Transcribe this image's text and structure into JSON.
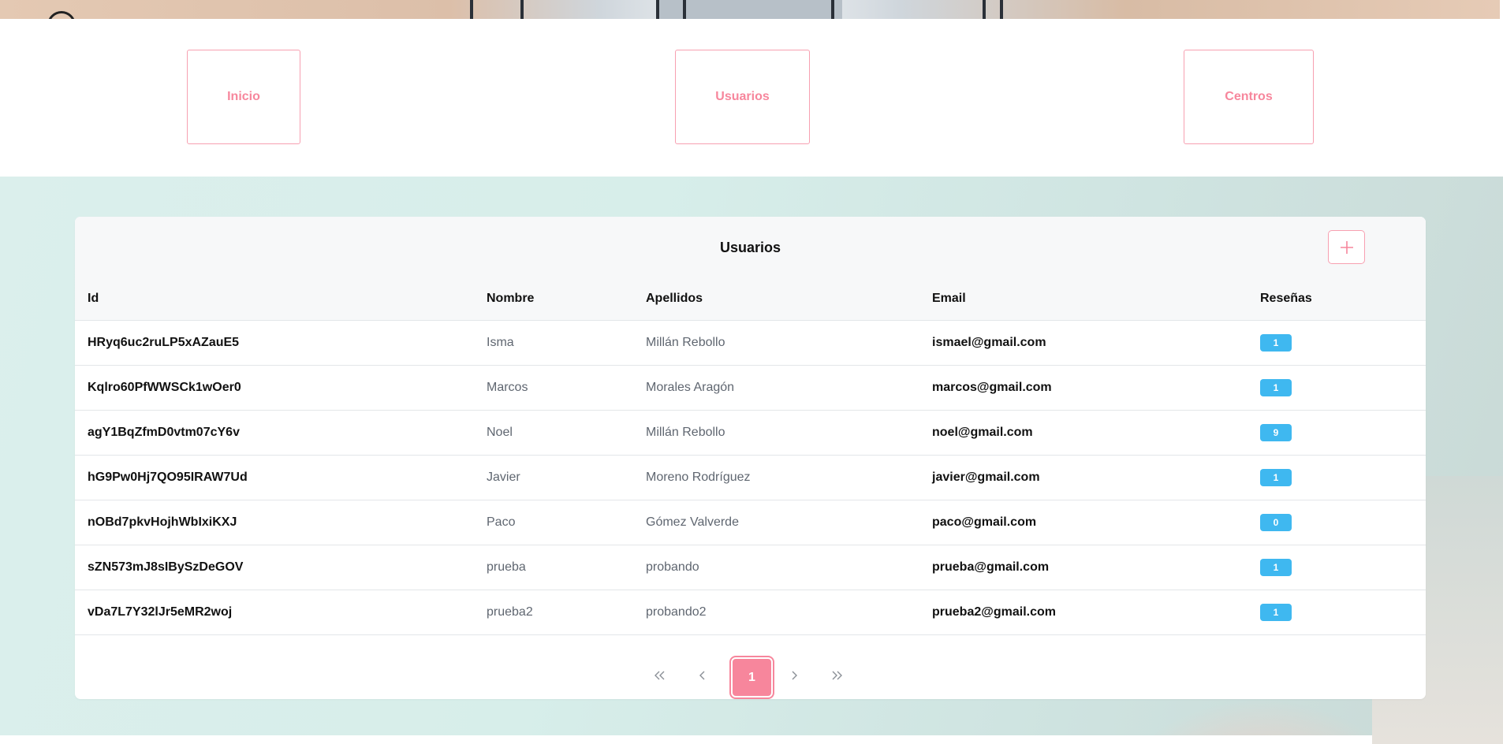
{
  "nav": {
    "items": [
      {
        "label": "Inicio"
      },
      {
        "label": "Usuarios"
      },
      {
        "label": "Centros"
      }
    ]
  },
  "card": {
    "title": "Usuarios",
    "add_icon": "plus-icon"
  },
  "table": {
    "headers": {
      "id": "Id",
      "nombre": "Nombre",
      "apellidos": "Apellidos",
      "email": "Email",
      "resenas": "Reseñas"
    },
    "rows": [
      {
        "id": "HRyq6uc2ruLP5xAZauE5",
        "nombre": "Isma",
        "apellidos": "Millán Rebollo",
        "email": "ismael@gmail.com",
        "resenas": "1"
      },
      {
        "id": "Kqlro60PfWWSCk1wOer0",
        "nombre": "Marcos",
        "apellidos": "Morales Aragón",
        "email": "marcos@gmail.com",
        "resenas": "1"
      },
      {
        "id": "agY1BqZfmD0vtm07cY6v",
        "nombre": "Noel",
        "apellidos": "Millán Rebollo",
        "email": "noel@gmail.com",
        "resenas": "9"
      },
      {
        "id": "hG9Pw0Hj7QO95IRAW7Ud",
        "nombre": "Javier",
        "apellidos": "Moreno Rodríguez",
        "email": "javier@gmail.com",
        "resenas": "1"
      },
      {
        "id": "nOBd7pkvHojhWbIxiKXJ",
        "nombre": "Paco",
        "apellidos": "Gómez Valverde",
        "email": "paco@gmail.com",
        "resenas": "0"
      },
      {
        "id": "sZN573mJ8sIBySzDeGOV",
        "nombre": "prueba",
        "apellidos": "probando",
        "email": "prueba@gmail.com",
        "resenas": "1"
      },
      {
        "id": "vDa7L7Y32lJr5eMR2woj",
        "nombre": "prueba2",
        "apellidos": "probando2",
        "email": "prueba2@gmail.com",
        "resenas": "1"
      }
    ]
  },
  "pagination": {
    "first_icon": "double-chevron-left-icon",
    "prev_icon": "chevron-left-icon",
    "current_page": "1",
    "next_icon": "chevron-right-icon",
    "last_icon": "double-chevron-right-icon"
  },
  "colors": {
    "accent": "#f7869c",
    "badge": "#3fb8f0",
    "background": "#d7eeea"
  }
}
